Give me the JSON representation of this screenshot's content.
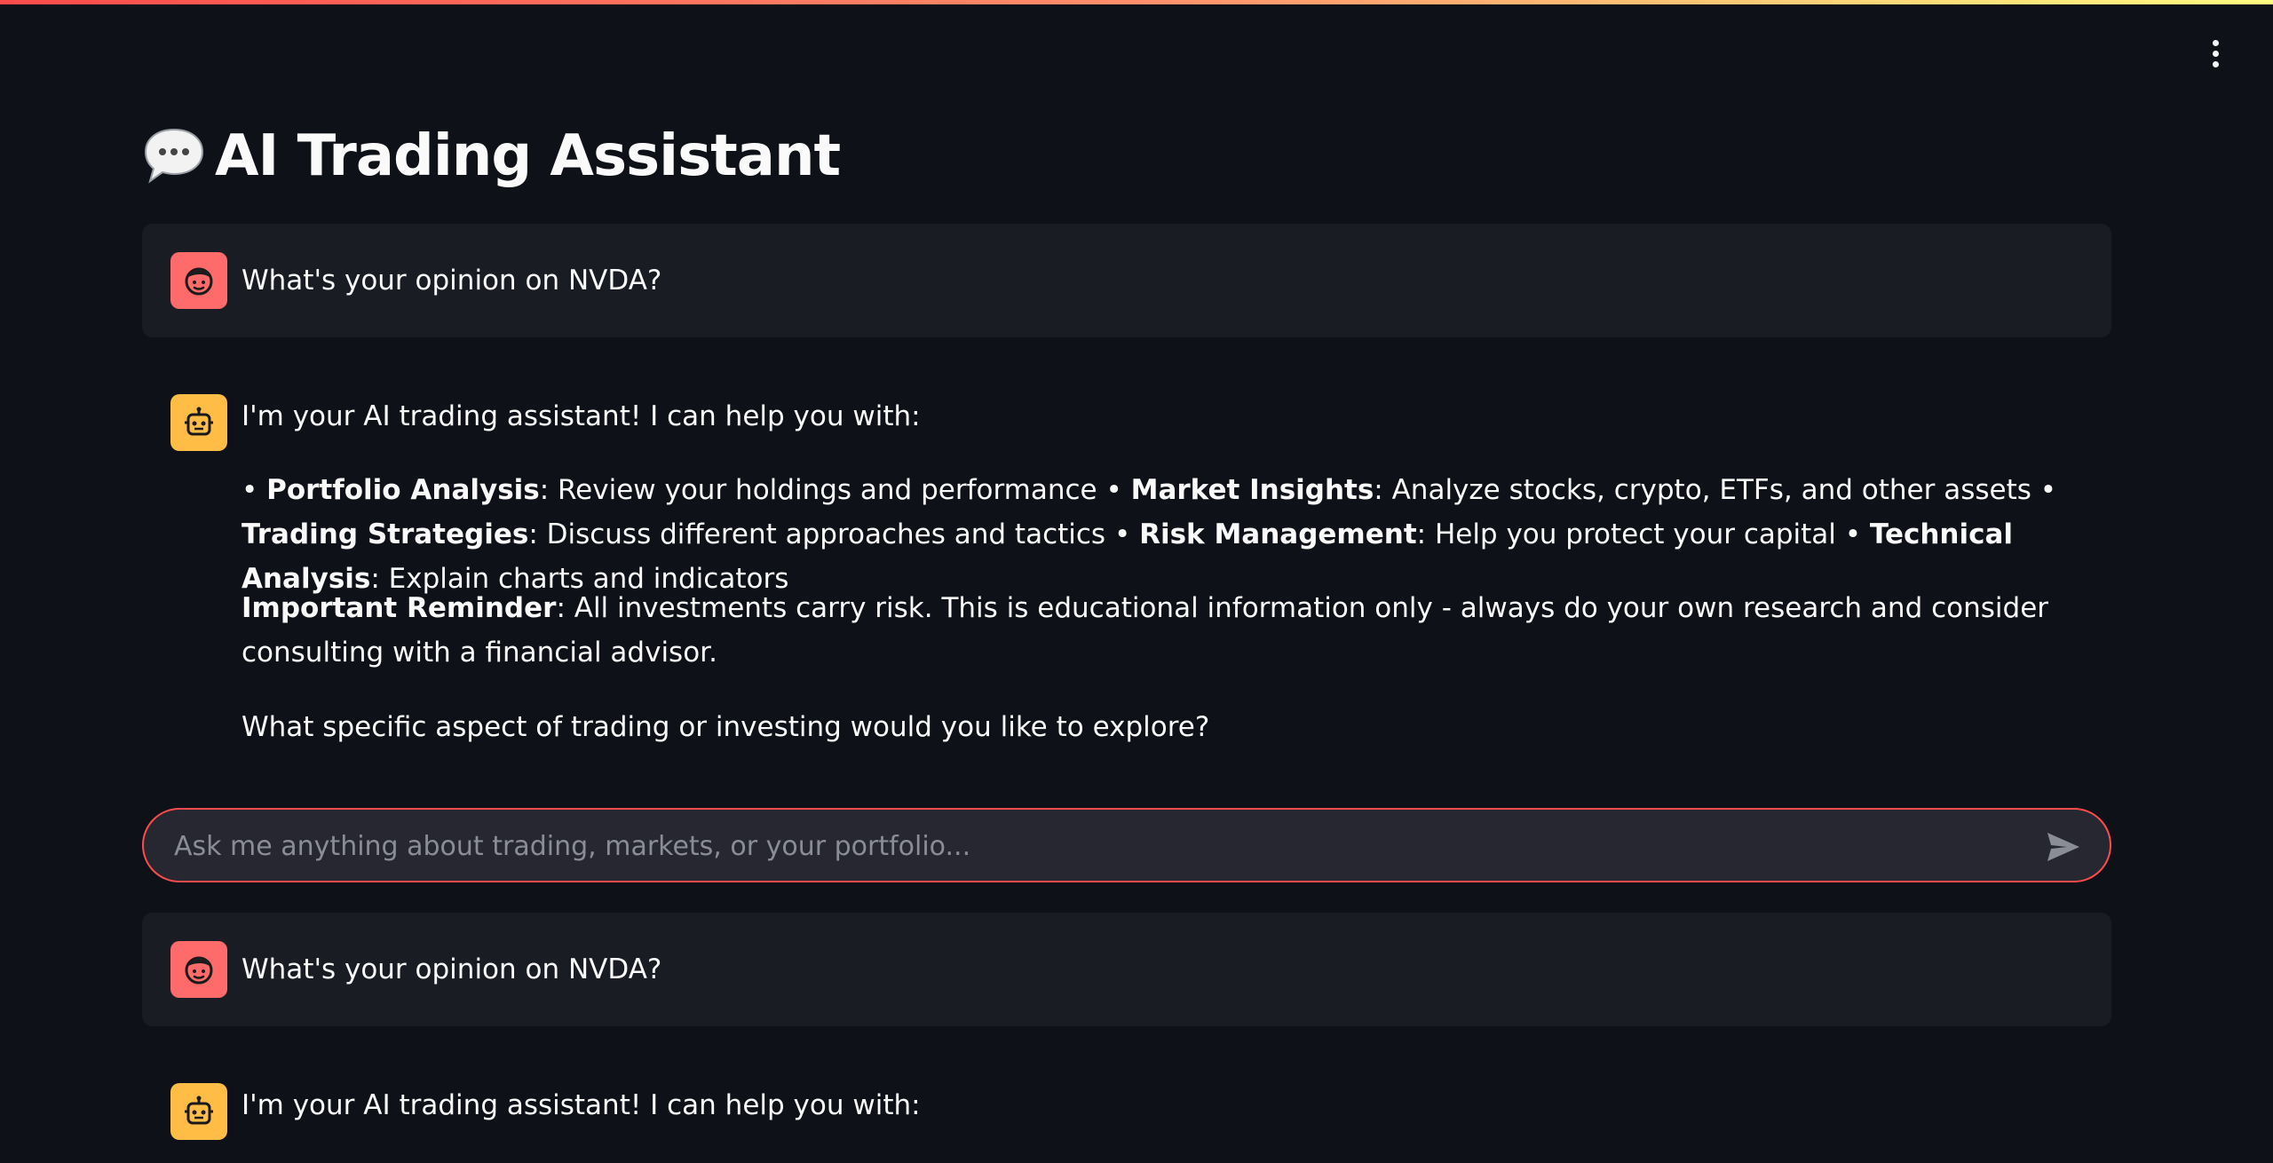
{
  "app": {
    "title": "AI Trading Assistant",
    "accent_color": "#ff4b4b",
    "background_color": "#0e1117"
  },
  "header": {
    "menu_icon": "vertical-dots-icon",
    "title_icon": "speech-bubble-icon"
  },
  "messages": [
    {
      "role": "user",
      "avatar_icon": "user-face-icon",
      "text": "What's your opinion on NVDA?"
    },
    {
      "role": "assistant",
      "avatar_icon": "robot-icon",
      "intro": "I'm your AI trading assistant! I can help you with:",
      "features": [
        {
          "bullet": "• ",
          "title": "Portfolio Analysis",
          "desc": ": Review your holdings and performance "
        },
        {
          "bullet": "• ",
          "title": "Market Insights",
          "desc": ": Analyze stocks, crypto, ETFs, and other assets "
        },
        {
          "bullet": "• ",
          "title": "Trading Strategies",
          "desc": ": Discuss different approaches and tactics "
        },
        {
          "bullet": "• ",
          "title": "Risk Management",
          "desc": ": Help you protect your capital "
        },
        {
          "bullet": "• ",
          "title": "Technical Analysis",
          "desc": ": Explain charts and indicators"
        }
      ],
      "reminder_title": "Important Reminder",
      "reminder_text": ": All investments carry risk. This is educational information only - always do your own research and consider consulting with a financial advisor.",
      "closing": "What specific aspect of trading or investing would you like to explore?"
    },
    {
      "role": "user",
      "avatar_icon": "user-face-icon",
      "text": "What's your opinion on NVDA?"
    },
    {
      "role": "assistant",
      "avatar_icon": "robot-icon",
      "intro": "I'm your AI trading assistant! I can help you with:"
    }
  ],
  "chat_input": {
    "placeholder": "Ask me anything about trading, markets, or your portfolio...",
    "value": "",
    "send_icon": "send-arrow-icon"
  }
}
